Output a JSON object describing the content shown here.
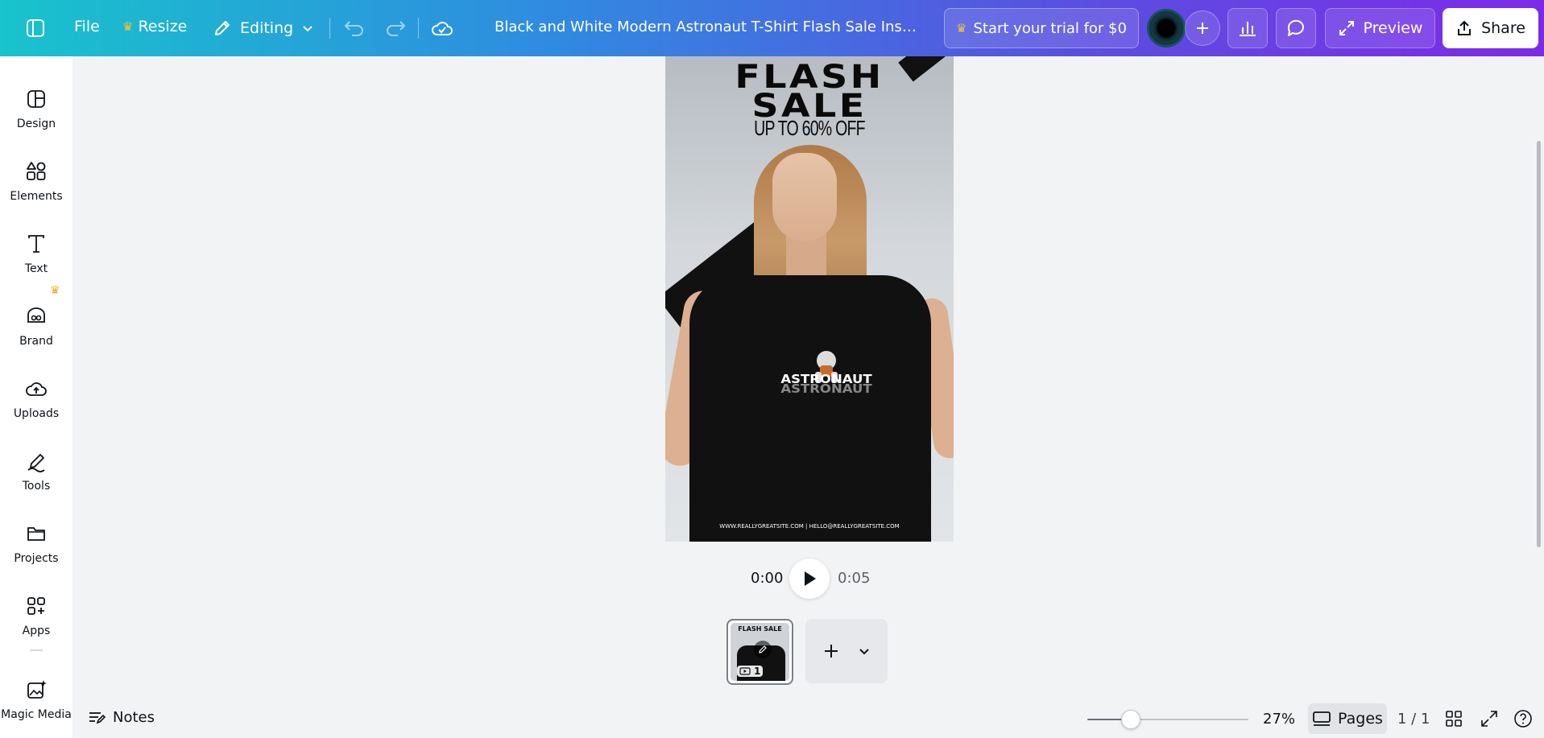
{
  "topbar": {
    "menu_icon": "sidebar-toggle-icon",
    "file_label": "File",
    "resize_label": "Resize",
    "editing_label": "Editing",
    "design_title": "Black and White Modern Astronaut T-Shirt Flash Sale Instag...",
    "trial_label": "Start your trial for $0",
    "preview_label": "Preview",
    "share_label": "Share",
    "brand_color": "#7d2ae8",
    "crown_color": "#f5a623"
  },
  "sidebar": {
    "items": [
      {
        "label": "Design",
        "icon": "design-icon"
      },
      {
        "label": "Elements",
        "icon": "elements-icon"
      },
      {
        "label": "Text",
        "icon": "text-icon"
      },
      {
        "label": "Brand",
        "icon": "brand-icon"
      },
      {
        "label": "Uploads",
        "icon": "uploads-icon"
      },
      {
        "label": "Tools",
        "icon": "tools-icon"
      },
      {
        "label": "Projects",
        "icon": "projects-icon"
      },
      {
        "label": "Apps",
        "icon": "apps-icon"
      },
      {
        "label": "Magic Media",
        "icon": "magic-media-icon"
      }
    ]
  },
  "poster": {
    "headline": "FLASH SALE",
    "subhead": "UP TO 60% OFF",
    "shirt_text": "ASTRONAUT",
    "contact": "WWW.REALLYGREATSITE.COM | HELLO@REALLYGREATSITE.COM"
  },
  "playback": {
    "current_time": "0:00",
    "duration": "0:05"
  },
  "pages": {
    "thumb_page_number": "1",
    "thumb_title": "FLASH SALE"
  },
  "bottombar": {
    "notes_label": "Notes",
    "zoom_label": "27%",
    "zoom_fraction": 0.27,
    "pages_label": "Pages",
    "page_count": "1 / 1"
  }
}
